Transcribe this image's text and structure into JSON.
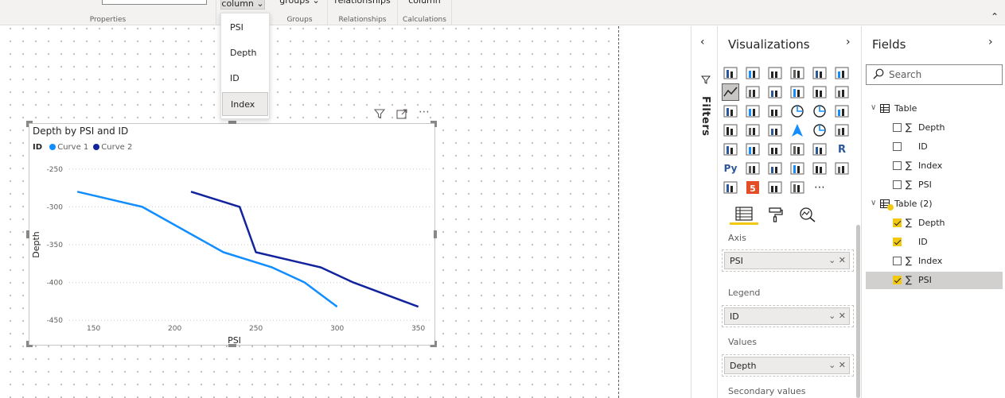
{
  "ribbon": {
    "groups": [
      {
        "label": "Properties",
        "button": ""
      },
      {
        "label": "Groups",
        "button": "groups"
      },
      {
        "label": "Relationships",
        "button": "relationships"
      },
      {
        "label": "Calculations",
        "button": "column"
      }
    ],
    "sort_button": "column"
  },
  "dropdown": {
    "options": [
      "PSI",
      "Depth",
      "ID",
      "Index"
    ],
    "selected": "Index"
  },
  "visual": {
    "title": "Depth by PSI and ID",
    "legend_title": "ID",
    "header_icons": [
      "filter-icon",
      "focus-mode-icon",
      "more-options-icon"
    ]
  },
  "chart_data": {
    "type": "line",
    "title": "Depth by PSI and ID",
    "xlabel": "PSI",
    "ylabel": "Depth",
    "xlim": [
      135,
      358
    ],
    "ylim": [
      -455,
      -245
    ],
    "x_ticks": [
      150,
      200,
      250,
      300,
      350
    ],
    "y_ticks": [
      -250,
      -300,
      -350,
      -400,
      -450
    ],
    "legend_title": "ID",
    "legend_position": "top-left",
    "grid": "horizontal dotted",
    "series": [
      {
        "name": "Curve 1",
        "color": "#118DFF",
        "points": [
          [
            140,
            -280
          ],
          [
            180,
            -300
          ],
          [
            230,
            -360
          ],
          [
            260,
            -380
          ],
          [
            280,
            -400
          ],
          [
            300,
            -432
          ]
        ]
      },
      {
        "name": "Curve 2",
        "color": "#12239E",
        "points": [
          [
            210,
            -280
          ],
          [
            240,
            -300
          ],
          [
            250,
            -360
          ],
          [
            290,
            -380
          ],
          [
            310,
            -400
          ],
          [
            350,
            -432
          ]
        ]
      }
    ]
  },
  "filters": {
    "label": "Filters"
  },
  "visualizations": {
    "title": "Visualizations",
    "tabs": [
      "fields-tab-icon",
      "format-paint-roller-icon",
      "analytics-magnifier-icon"
    ],
    "wells": [
      {
        "label": "Axis",
        "value": "PSI"
      },
      {
        "label": "Legend",
        "value": "ID"
      },
      {
        "label": "Values",
        "value": "Depth"
      },
      {
        "label": "Secondary values",
        "value": ""
      }
    ]
  },
  "fields": {
    "title": "Fields",
    "search_placeholder": "Search",
    "tables": [
      {
        "name": "Table",
        "fields": [
          {
            "name": "Depth",
            "sigma": true,
            "checked": false
          },
          {
            "name": "ID",
            "sigma": false,
            "checked": false
          },
          {
            "name": "Index",
            "sigma": true,
            "checked": false
          },
          {
            "name": "PSI",
            "sigma": true,
            "checked": false
          }
        ]
      },
      {
        "name": "Table (2)",
        "fields": [
          {
            "name": "Depth",
            "sigma": true,
            "checked": true
          },
          {
            "name": "ID",
            "sigma": false,
            "checked": true
          },
          {
            "name": "Index",
            "sigma": true,
            "checked": false
          },
          {
            "name": "PSI",
            "sigma": true,
            "checked": true
          }
        ]
      }
    ]
  },
  "colors": {
    "accent": "#F2C811",
    "series1": "#118DFF",
    "series2": "#12239E"
  }
}
